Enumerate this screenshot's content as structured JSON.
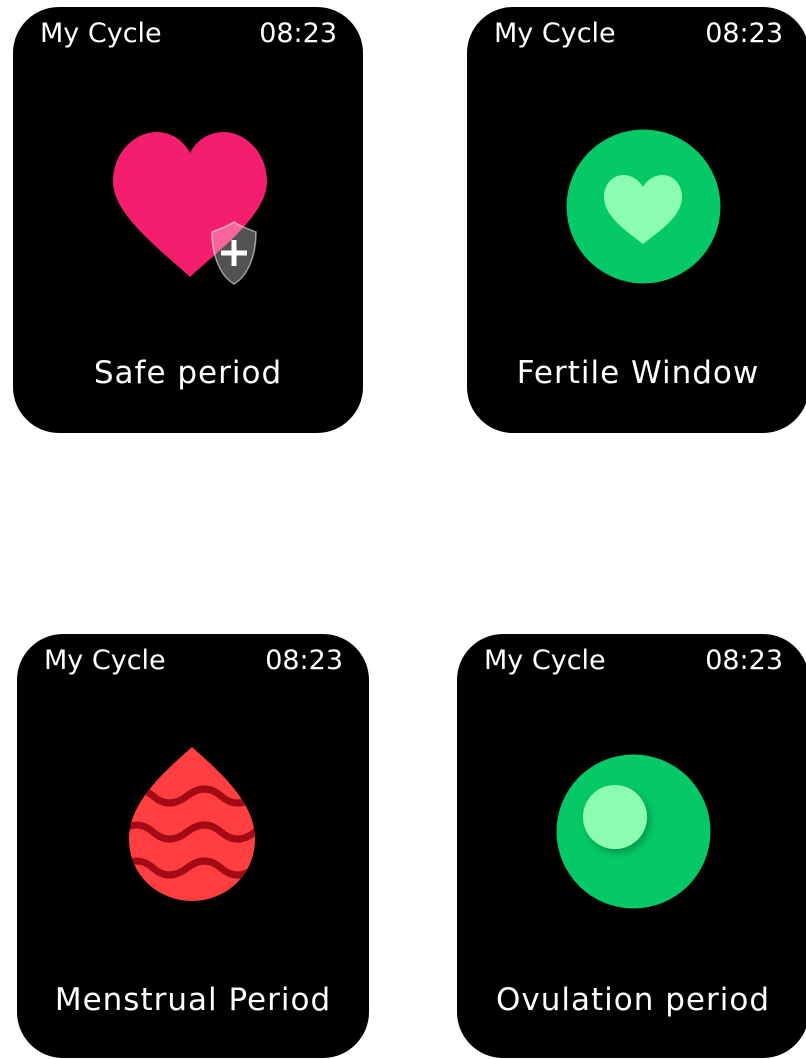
{
  "screens": [
    {
      "app_title": "My Cycle",
      "time": "08:23",
      "status": "Safe period",
      "icon": "heart-shield-icon",
      "colors": {
        "heart": "#F51D6E",
        "shield": "#FFFFFF"
      }
    },
    {
      "app_title": "My Cycle",
      "time": "08:23",
      "status": "Fertile Window",
      "icon": "heart-in-circle-icon",
      "colors": {
        "circle": "#05C967",
        "heart": "#8CFCB0"
      }
    },
    {
      "app_title": "My Cycle",
      "time": "08:23",
      "status": "Menstrual Period",
      "icon": "blood-drop-icon",
      "colors": {
        "drop": "#FF3F3F",
        "waves": "#A30A16"
      }
    },
    {
      "app_title": "My Cycle",
      "time": "08:23",
      "status": "Ovulation period",
      "icon": "ovum-circle-icon",
      "colors": {
        "circle": "#05C967",
        "ovum": "#8CFCB0"
      }
    }
  ]
}
